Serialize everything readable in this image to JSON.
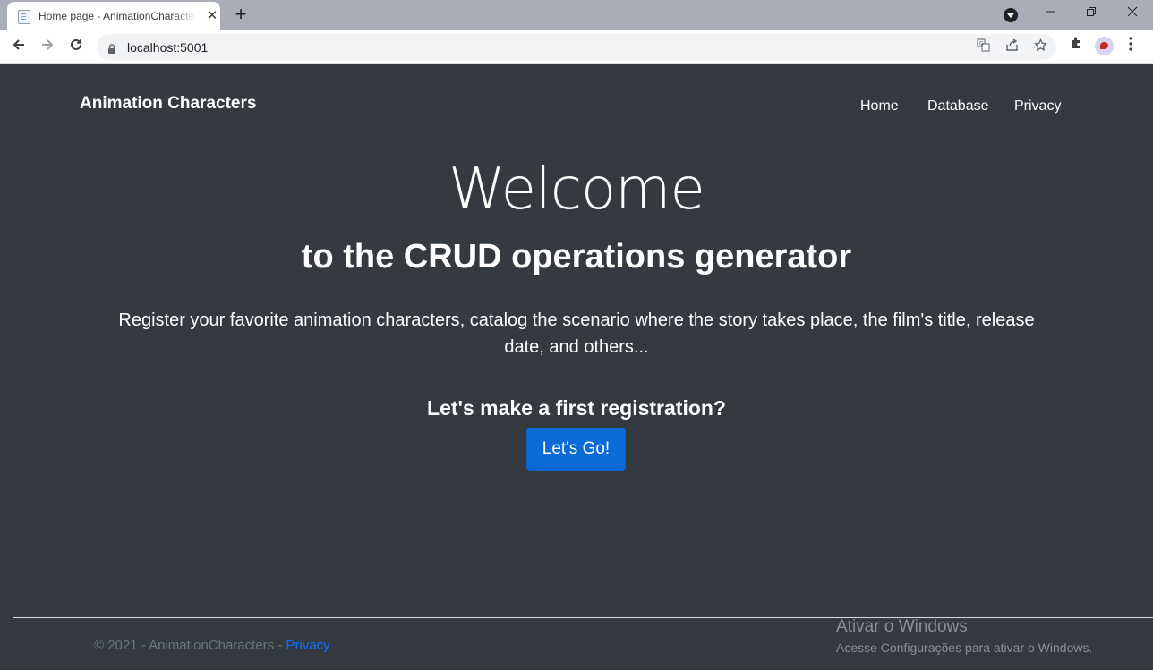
{
  "browser": {
    "tab_title": "Home page - AnimationCharacters",
    "tab_close": "✕",
    "new_tab": "+",
    "url": "localhost:5001",
    "icons": [
      "page-icon",
      "close-icon",
      "plus-icon",
      "back-arrow-icon",
      "forward-arrow-icon",
      "reload-icon",
      "lock-icon",
      "translate-icon",
      "share-icon",
      "star-icon",
      "puzzle-icon",
      "avatar",
      "kebab-menu-icon",
      "minimize-icon",
      "restore-icon",
      "close-window-icon"
    ]
  },
  "navbar": {
    "brand": "Animation Characters",
    "links": [
      "Home",
      "Database",
      "Privacy"
    ]
  },
  "hero": {
    "title": "Welcome",
    "subtitle": "to the CRUD operations generator",
    "lead": "Register your favorite animation characters, catalog the scenario where the story takes place, the film's title, release date, and others...",
    "cta_heading": "Let's make a first registration?",
    "cta_button": "Let's Go!"
  },
  "footer": {
    "text": "© 2021 - AnimationCharacters - ",
    "link": "Privacy"
  },
  "watermark": {
    "title": "Ativar o Windows",
    "subtitle": "Acesse Configurações para ativar o Windows."
  },
  "colors": {
    "page_background": "#343a40",
    "primary_button": "#0b6bd6",
    "footer_link": "#0d6efd",
    "footer_text": "#6c757d"
  }
}
